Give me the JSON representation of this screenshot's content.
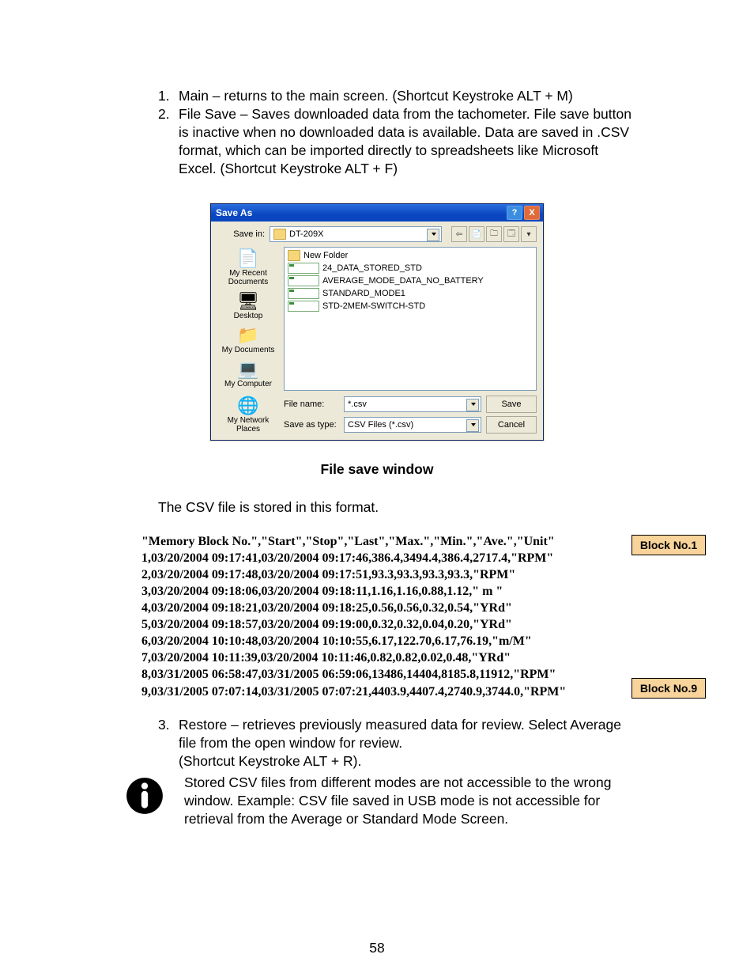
{
  "list": {
    "n1": "1.",
    "item1": "Main – returns to the main screen. (Shortcut Keystroke ALT + M)",
    "n2": "2.",
    "item2": "File Save – Saves downloaded data from the tachometer. File save button is inactive when no downloaded data is available.  Data are saved in .CSV format, which can be imported directly to spreadsheets like Microsoft Excel.  (Shortcut Keystroke ALT + F)",
    "n3": "3.",
    "item3": "Restore – retrieves previously measured data for review.  Select Average file from the open window for review.\n(Shortcut Keystroke ALT + R)."
  },
  "dialog": {
    "title": "Save As",
    "help": "?",
    "close": "X",
    "saveInLabel": "Save in:",
    "saveInValue": "DT-209X",
    "toolbtns": [
      "⇦",
      "📄",
      "🗀",
      "🗔",
      "▾"
    ],
    "places": [
      {
        "icon": "📄",
        "label": "My Recent Documents"
      },
      {
        "icon": "🖥",
        "label": "Desktop"
      },
      {
        "icon": "📁",
        "label": "My Documents"
      },
      {
        "icon": "💻",
        "label": "My Computer"
      },
      {
        "icon": "🌐",
        "label": "My Network Places"
      }
    ],
    "files": [
      {
        "type": "folder",
        "name": "New Folder"
      },
      {
        "type": "csv",
        "name": "24_DATA_STORED_STD"
      },
      {
        "type": "csv",
        "name": "AVERAGE_MODE_DATA_NO_BATTERY"
      },
      {
        "type": "csv",
        "name": "STANDARD_MODE1"
      },
      {
        "type": "csv",
        "name": "STD-2MEM-SWITCH-STD"
      }
    ],
    "fileNameLabel": "File name:",
    "fileNameValue": "*.csv",
    "saveTypeLabel": "Save as type:",
    "saveTypeValue": "CSV Files (*.csv)",
    "saveBtn": "Save",
    "cancelBtn": "Cancel"
  },
  "caption": "File save window",
  "storedPara": "The CSV file is stored in this format.",
  "csv": {
    "header": "\"Memory Block No.\",\"Start\",\"Stop\",\"Last\",\"Max.\",\"Min.\",\"Ave.\",\"Unit\"",
    "rows": [
      "1,03/20/2004 09:17:41,03/20/2004 09:17:46,386.4,3494.4,386.4,2717.4,\"RPM\"",
      "2,03/20/2004 09:17:48,03/20/2004 09:17:51,93.3,93.3,93.3,93.3,\"RPM\"",
      "3,03/20/2004 09:18:06,03/20/2004 09:18:11,1.16,1.16,0.88,1.12,\" m \"",
      "4,03/20/2004 09:18:21,03/20/2004 09:18:25,0.56,0.56,0.32,0.54,\"YRd\"",
      "5,03/20/2004 09:18:57,03/20/2004 09:19:00,0.32,0.32,0.04,0.20,\"YRd\"",
      "6,03/20/2004 10:10:48,03/20/2004 10:10:55,6.17,122.70,6.17,76.19,\"m/M\"",
      "7,03/20/2004 10:11:39,03/20/2004 10:11:46,0.82,0.82,0.02,0.48,\"YRd\"",
      "8,03/31/2005 06:58:47,03/31/2005 06:59:06,13486,14404,8185.8,11912,\"RPM\"",
      "9,03/31/2005 07:07:14,03/31/2005 07:07:21,4403.9,4407.4,2740.9,3744.0,\"RPM\""
    ]
  },
  "tags": {
    "b1": "Block No.1",
    "b9": "Block No.9"
  },
  "warning": "Stored CSV files from different modes are not accessible to the wrong window.  Example: CSV file saved in USB mode is not accessible for retrieval from the Average or Standard Mode Screen.",
  "pageNumber": "58"
}
